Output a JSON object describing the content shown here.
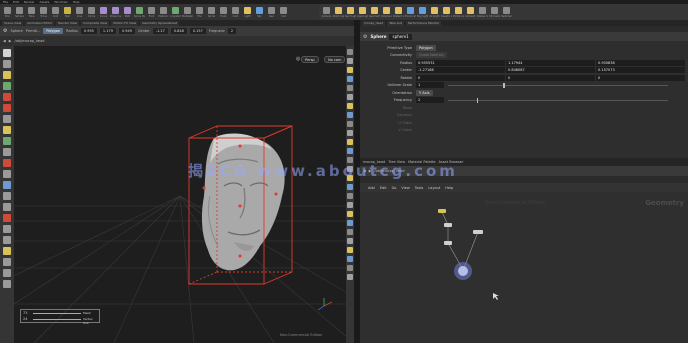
{
  "menubar": {
    "items": [
      "File",
      "Edit",
      "Render",
      "Assets",
      "Windows",
      "Help"
    ]
  },
  "shelf_left": {
    "tabs": [
      "Create",
      "Modify",
      "Model",
      "Polygon",
      "Deform",
      "Texture",
      "Rigging",
      "Characters",
      "Constraints",
      "Hair Utils",
      "Guide Process"
    ],
    "tools": [
      {
        "label": "Box",
        "color": "#8a8a8a"
      },
      {
        "label": "Sphere",
        "color": "#8a8a8a"
      },
      {
        "label": "Tube",
        "color": "#8a8a8a"
      },
      {
        "label": "Torus",
        "color": "#8a8a8a"
      },
      {
        "label": "Grid",
        "color": "#8a8a8a"
      },
      {
        "label": "Null",
        "color": "#c9b24a"
      },
      {
        "label": "Line",
        "color": "#8a8a8a"
      },
      {
        "label": "Circle",
        "color": "#8a8a8a"
      },
      {
        "label": "Curve",
        "color": "#a88cd0"
      },
      {
        "label": "Draw Curve",
        "color": "#a88cd0"
      },
      {
        "label": "Path",
        "color": "#a88cd0"
      },
      {
        "label": "Spray Paint",
        "color": "#6fa86f"
      },
      {
        "label": "Font",
        "color": "#8a8a8a"
      },
      {
        "label": "Platonic",
        "color": "#8a8a8a"
      },
      {
        "label": "L-System",
        "color": "#6fa86f"
      },
      {
        "label": "Metaball",
        "color": "#8a8a8a"
      },
      {
        "label": "File",
        "color": "#8a8a8a"
      },
      {
        "label": "Spiral",
        "color": "#8a8a8a"
      },
      {
        "label": "Helix",
        "color": "#8a8a8a"
      },
      {
        "label": "Cam",
        "color": "#8a8a8a"
      },
      {
        "label": "Light",
        "color": "#e0c060"
      },
      {
        "label": "Sky",
        "color": "#60a0e0"
      },
      {
        "label": "Geo",
        "color": "#8a8a8a"
      },
      {
        "label": "Inst",
        "color": "#8a8a8a"
      }
    ]
  },
  "shelf_right": {
    "tabs": [
      "Lights and Cameras",
      "Collisions",
      "Particles",
      "Grains",
      "Vellum",
      "Rigid Bodies",
      "Particle Fluids",
      "Viscous Fluids",
      "Oceans",
      "Fluid Containers",
      "Populate Containers",
      "Container Tools",
      "Pyro FX"
    ],
    "tools": [
      {
        "label": "Camera",
        "color": "#8a8a8a"
      },
      {
        "label": "Point Light",
        "color": "#e0c060"
      },
      {
        "label": "Spot Light",
        "color": "#e0c060"
      },
      {
        "label": "Area Light",
        "color": "#e0c060"
      },
      {
        "label": "Geometry Light",
        "color": "#e0c060"
      },
      {
        "label": "Volume Light",
        "color": "#e0c060"
      },
      {
        "label": "Distant Light",
        "color": "#e0c060"
      },
      {
        "label": "Environment Light",
        "color": "#60a0e0"
      },
      {
        "label": "Sky Light",
        "color": "#60a0e0"
      },
      {
        "label": "GI Light",
        "color": "#e0c060"
      },
      {
        "label": "Caustic Light",
        "color": "#e0c060"
      },
      {
        "label": "Portal Light",
        "color": "#e0c060"
      },
      {
        "label": "Ambient Light",
        "color": "#e0c060"
      },
      {
        "label": "Stereo Camera",
        "color": "#8a8a8a"
      },
      {
        "label": "VR Camera",
        "color": "#8a8a8a"
      },
      {
        "label": "Switcher",
        "color": "#8a8a8a"
      }
    ]
  },
  "left_pane_tabs": [
    "Scene View",
    "Animation Editor",
    "Render View",
    "Composite View",
    "Motion FX View",
    "Geometry Spreadsheet"
  ],
  "viewport": {
    "node_type": "Sphere",
    "node_name": "Primiti...",
    "primitive_type": "Polygon",
    "radius_label": "Radius",
    "radius_values": [
      "0.955",
      "1.179",
      "0.949"
    ],
    "center_label": "Center",
    "center_values": [
      "-1.27",
      "0.848",
      "0.157"
    ],
    "frequency_label": "Frequenc",
    "frequency_value": "2",
    "path": "/obj/mocap_head",
    "persp_label": "Persp",
    "cam_label": "No cam",
    "corner_label": "Non-Commercial Edition",
    "mini_values": [
      "73",
      "24"
    ],
    "mini_labels": [
      "Mesh",
      "Vertex Uvs"
    ]
  },
  "right_pane_tabs": [
    "mocap_head",
    "Take List",
    "Performance Monitor"
  ],
  "param_pane": {
    "node_type": "Sphere",
    "node_name": "sphere1",
    "rows": [
      {
        "label": "Primitive Type",
        "kind": "menu",
        "value": "Polygon",
        "dim": false
      },
      {
        "label": "Connectivity",
        "kind": "menu",
        "value": "Quadrilaterals",
        "dim": true
      },
      {
        "label": "Radius",
        "kind": "vec3",
        "values": [
          "0.955531",
          "1.17944",
          "0.950838"
        ]
      },
      {
        "label": "Center",
        "kind": "vec3",
        "values": [
          "-1.27188",
          "0.848087",
          "0.157073"
        ]
      },
      {
        "label": "Rotate",
        "kind": "vec3",
        "values": [
          "0",
          "0",
          "0"
        ]
      },
      {
        "label": "Uniform Scale",
        "kind": "slider",
        "value": "1",
        "fraction": 0.25
      },
      {
        "label": "Orientation",
        "kind": "menu",
        "value": "Y Axis",
        "dim": false
      },
      {
        "label": "Frequency",
        "kind": "slider",
        "value": "2",
        "fraction": 0.13
      },
      {
        "label": "Rows",
        "kind": "dim"
      },
      {
        "label": "Columns",
        "kind": "dim"
      },
      {
        "label": "U Order",
        "kind": "dim"
      },
      {
        "label": "V Order",
        "kind": "dim"
      }
    ]
  },
  "network_pane": {
    "tabs": [
      "mocap_head",
      "Tree View",
      "Material Palette",
      "Asset Browser"
    ],
    "path": "/obj/mocap_head",
    "menu": [
      "Add",
      "Edit",
      "Go",
      "View",
      "Tools",
      "Layout",
      "Help"
    ],
    "watermark": "Non-Commercial Edition",
    "context": "Geometry"
  },
  "watermark_text": "揭ZCG www.aboutcg.com",
  "colors": {
    "accent_blue": "#5a6e86",
    "bbox_red": "#e03a2a",
    "viewport_bg": "#1e1e1e",
    "node_yellow": "#d9c25a",
    "node_selected_blue": "#6f7bd8"
  }
}
